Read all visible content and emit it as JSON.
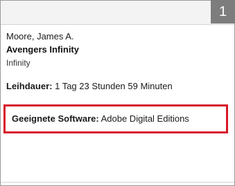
{
  "step_badge": "1",
  "loan": {
    "author": "Moore, James A.",
    "title": "Avengers Infinity",
    "subtitle": "Infinity",
    "duration_label": "Leihdauer:",
    "duration_value": "1 Tag 23 Stunden 59 Minuten",
    "software_label": "Geeignete Software:",
    "software_value": "Adobe Digital Editions"
  },
  "colors": {
    "badge": "#7d7d7d",
    "highlight": "#d7182a"
  }
}
